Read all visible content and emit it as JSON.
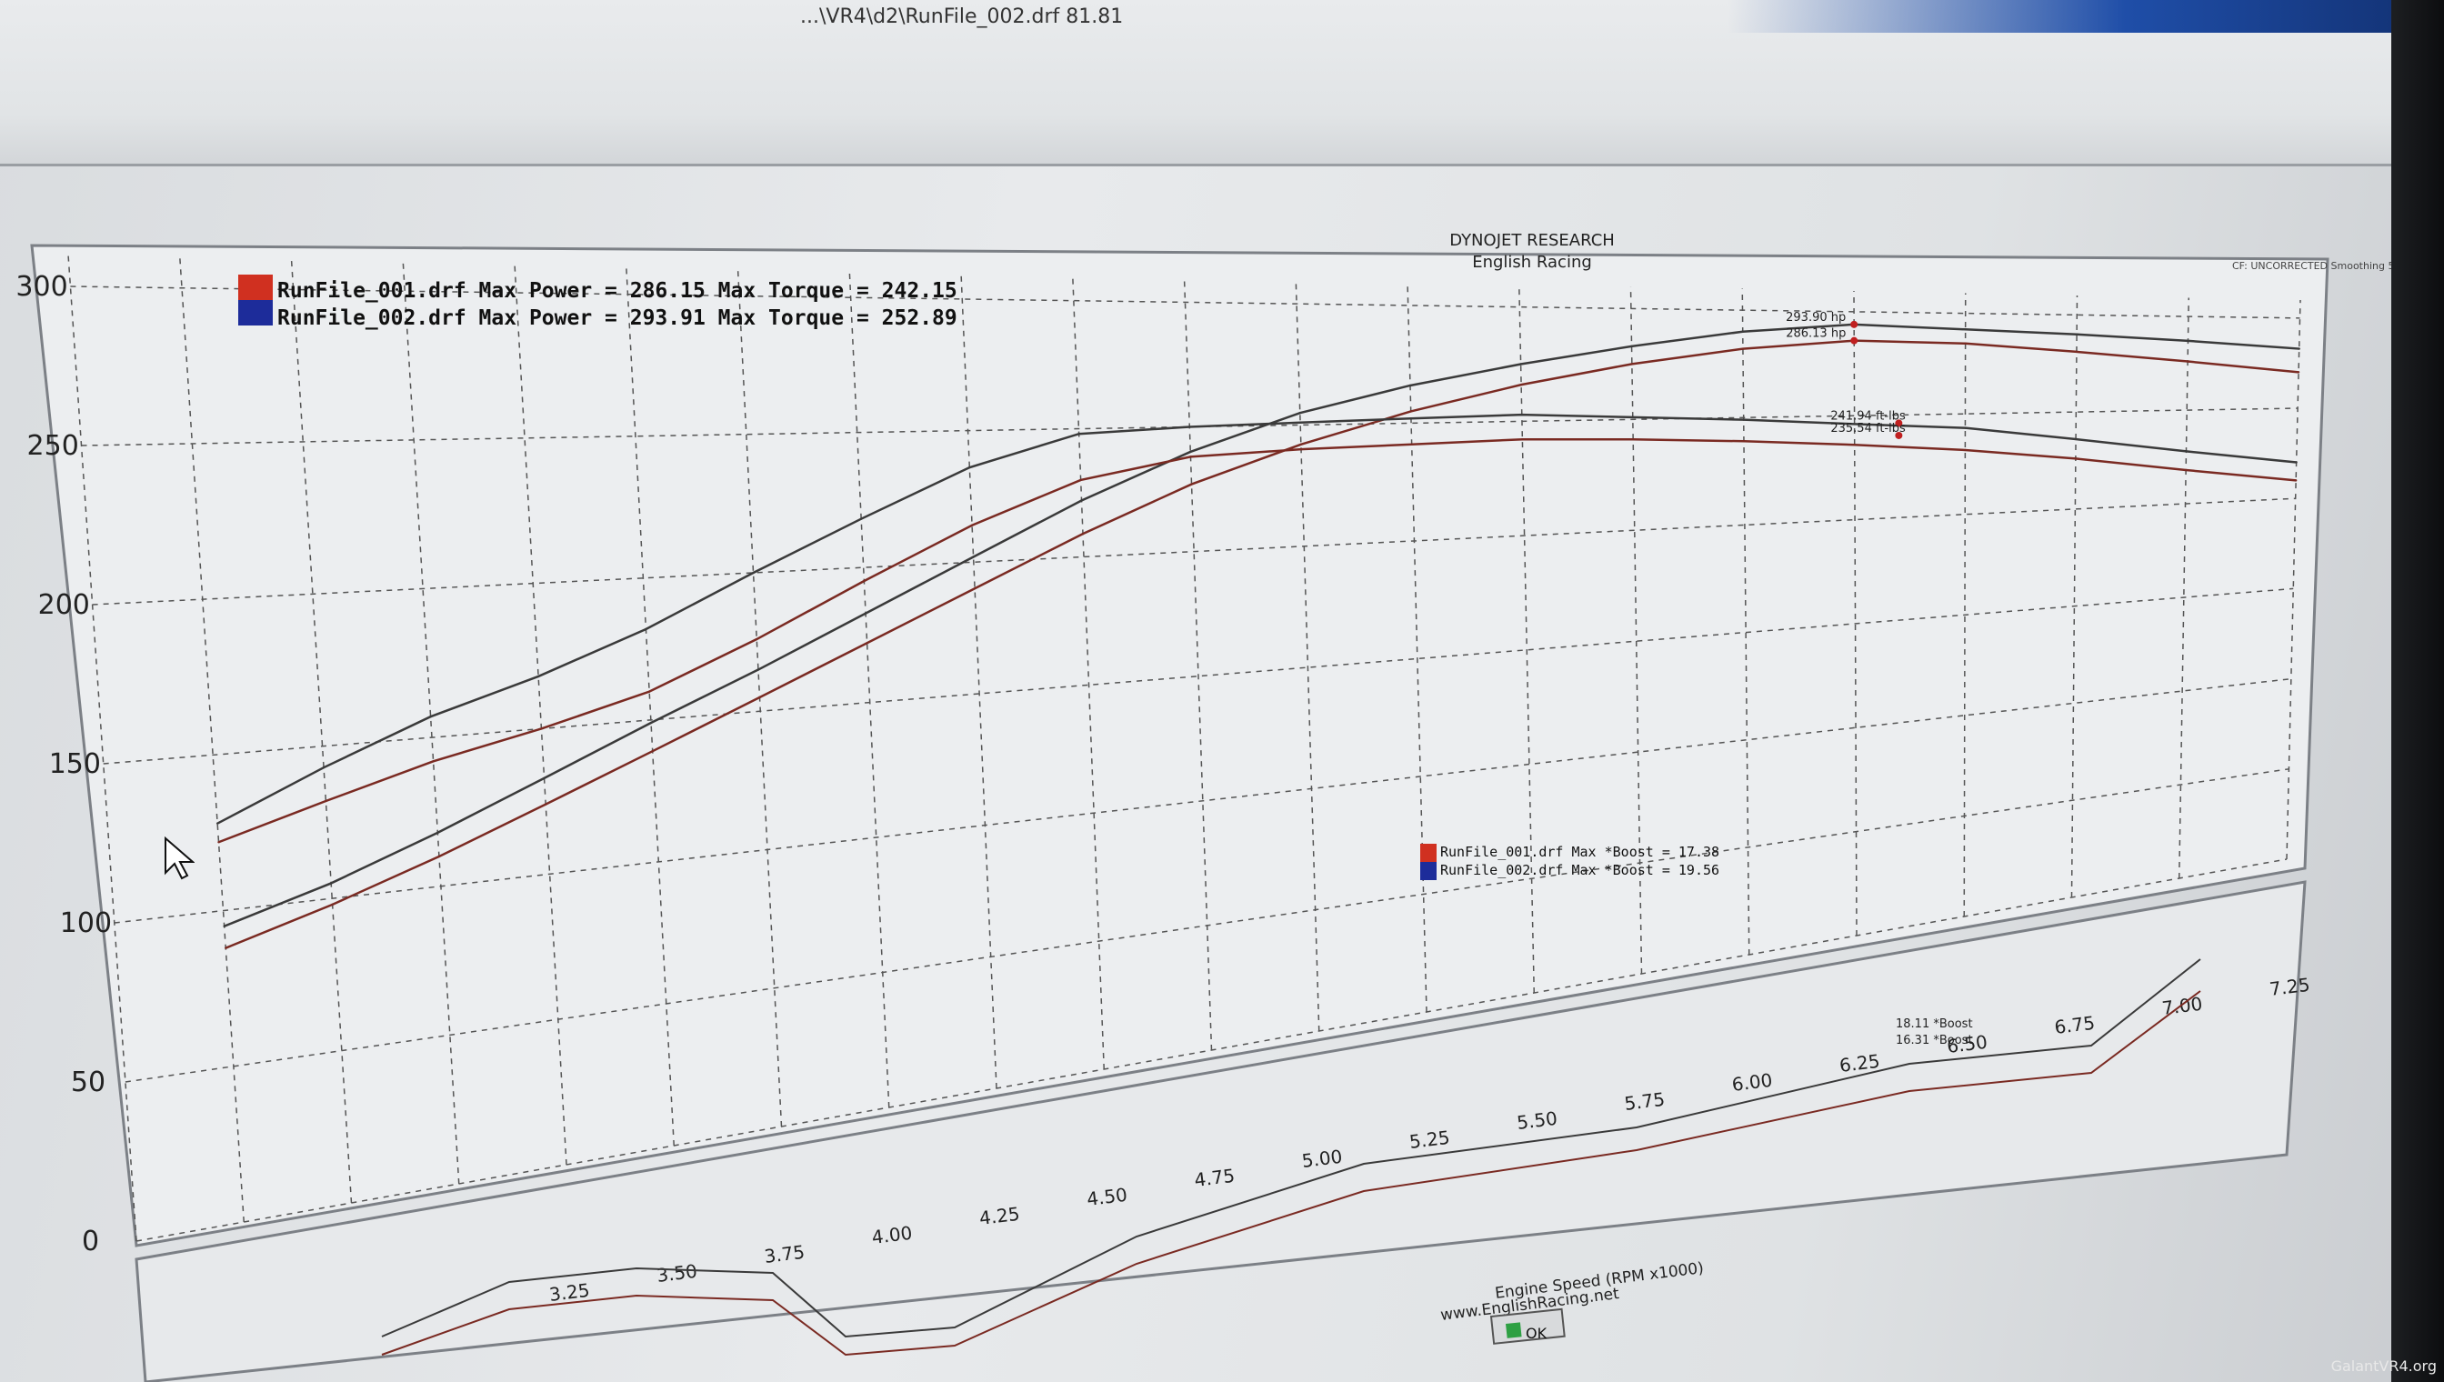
{
  "window": {
    "title": "...\\VR4\\d2\\RunFile_002.drf   81.81"
  },
  "header": {
    "line1": "DYNOJET RESEARCH",
    "line2": "English Racing",
    "corner_note": "CF: UNCORRECTED  Smoothing 5"
  },
  "legend_top": [
    {
      "file": "RunFile_001.drf",
      "text": "RunFile_001.drf Max Power = 286.15 Max Torque = 242.15",
      "color": "#d03020"
    },
    {
      "file": "RunFile_002.drf",
      "text": "RunFile_002.drf Max Power = 293.91 Max Torque = 252.89",
      "color": "#1d2c9a"
    }
  ],
  "legend_boost": [
    {
      "text": "RunFile_001.drf Max *Boost = 17.38",
      "color": "#d03020"
    },
    {
      "text": "RunFile_002.drf Max *Boost = 19.56",
      "color": "#1d2c9a"
    }
  ],
  "x_axis": {
    "title": "Engine Speed (RPM x1000)",
    "url": "www.EnglishRacing.net"
  },
  "ok_button": "OK",
  "watermark": "GalantVR4.org",
  "chart_data": {
    "type": "line",
    "xlim": [
      2.25,
      7.25
    ],
    "ylim": [
      0,
      310
    ],
    "y_ticks": [
      0,
      50,
      100,
      150,
      200,
      250,
      300
    ],
    "y_tick_labels": [
      "0",
      "50",
      "100",
      "150",
      "200",
      "250",
      "300"
    ],
    "x_ticks": [
      2.25,
      2.5,
      2.75,
      3.0,
      3.25,
      3.5,
      3.75,
      4.0,
      4.25,
      4.5,
      4.75,
      5.0,
      5.25,
      5.5,
      5.75,
      6.0,
      6.25,
      6.5,
      6.75,
      7.0,
      7.25
    ],
    "x_tick_labels": [
      "3.25",
      "3.50",
      "3.75",
      "4.00",
      "4.25",
      "4.50",
      "4.75",
      "5.00",
      "5.25",
      "5.50",
      "5.75",
      "6.00",
      "6.25",
      "6.50",
      "6.75",
      "7.00",
      "7.25"
    ],
    "grid": true,
    "series": [
      {
        "name": "RunFile_002.drf",
        "kind": "power",
        "color": "#3a3a3a",
        "x": [
          2.5,
          2.75,
          3.0,
          3.25,
          3.5,
          3.75,
          4.0,
          4.25,
          4.5,
          4.75,
          5.0,
          5.25,
          5.5,
          5.75,
          6.0,
          6.25,
          6.5,
          6.75,
          7.0,
          7.25
        ],
        "y": [
          95,
          105,
          118,
          133,
          149,
          165,
          183,
          202,
          222,
          240,
          255,
          266,
          275,
          283,
          290,
          293.9,
          292,
          290,
          287,
          283
        ]
      },
      {
        "name": "RunFile_001.drf",
        "kind": "power",
        "color": "#7a2a22",
        "x": [
          2.5,
          2.75,
          3.0,
          3.25,
          3.5,
          3.75,
          4.0,
          4.25,
          4.5,
          4.75,
          5.0,
          5.25,
          5.5,
          5.75,
          6.0,
          6.25,
          6.5,
          6.75,
          7.0,
          7.25
        ],
        "y": [
          88,
          98,
          110,
          124,
          139,
          155,
          172,
          190,
          209,
          227,
          242,
          255,
          266,
          275,
          282,
          286.1,
          285,
          281,
          276,
          270
        ]
      },
      {
        "name": "RunFile_002.drf",
        "kind": "torque",
        "color": "#3a3a3a",
        "x": [
          2.5,
          2.75,
          3.0,
          3.25,
          3.5,
          3.75,
          4.0,
          4.25,
          4.5,
          4.75,
          5.0,
          5.25,
          5.5,
          5.75,
          6.0,
          6.25,
          6.5,
          6.75,
          7.0,
          7.25
        ],
        "y": [
          128,
          143,
          157,
          168,
          182,
          200,
          218,
          236,
          248,
          250,
          251,
          252,
          252.9,
          251,
          249,
          246,
          243,
          236,
          228,
          220
        ]
      },
      {
        "name": "RunFile_001.drf",
        "kind": "torque",
        "color": "#7a2a22",
        "x": [
          2.5,
          2.75,
          3.0,
          3.25,
          3.5,
          3.75,
          4.0,
          4.25,
          4.5,
          4.75,
          5.0,
          5.25,
          5.5,
          5.75,
          6.0,
          6.25,
          6.5,
          6.75,
          7.0,
          7.25
        ],
        "y": [
          122,
          132,
          142,
          150,
          160,
          176,
          195,
          214,
          230,
          238,
          240,
          241,
          242.1,
          241,
          239,
          236,
          232,
          226,
          218,
          210
        ]
      }
    ],
    "peak_labels": [
      {
        "text": "293.90 hp",
        "x": 6.25,
        "y": 293.9
      },
      {
        "text": "286.13 hp",
        "x": 6.25,
        "y": 286.1
      },
      {
        "text": "241.94 ft-lbs",
        "x": 6.35,
        "y": 246
      },
      {
        "text": "235.54 ft-lbs",
        "x": 6.35,
        "y": 240
      }
    ],
    "boost_labels": [
      {
        "text": "18.11 *Boost",
        "x": 6.2
      },
      {
        "text": "16.31 *Boost",
        "x": 6.2
      }
    ]
  }
}
